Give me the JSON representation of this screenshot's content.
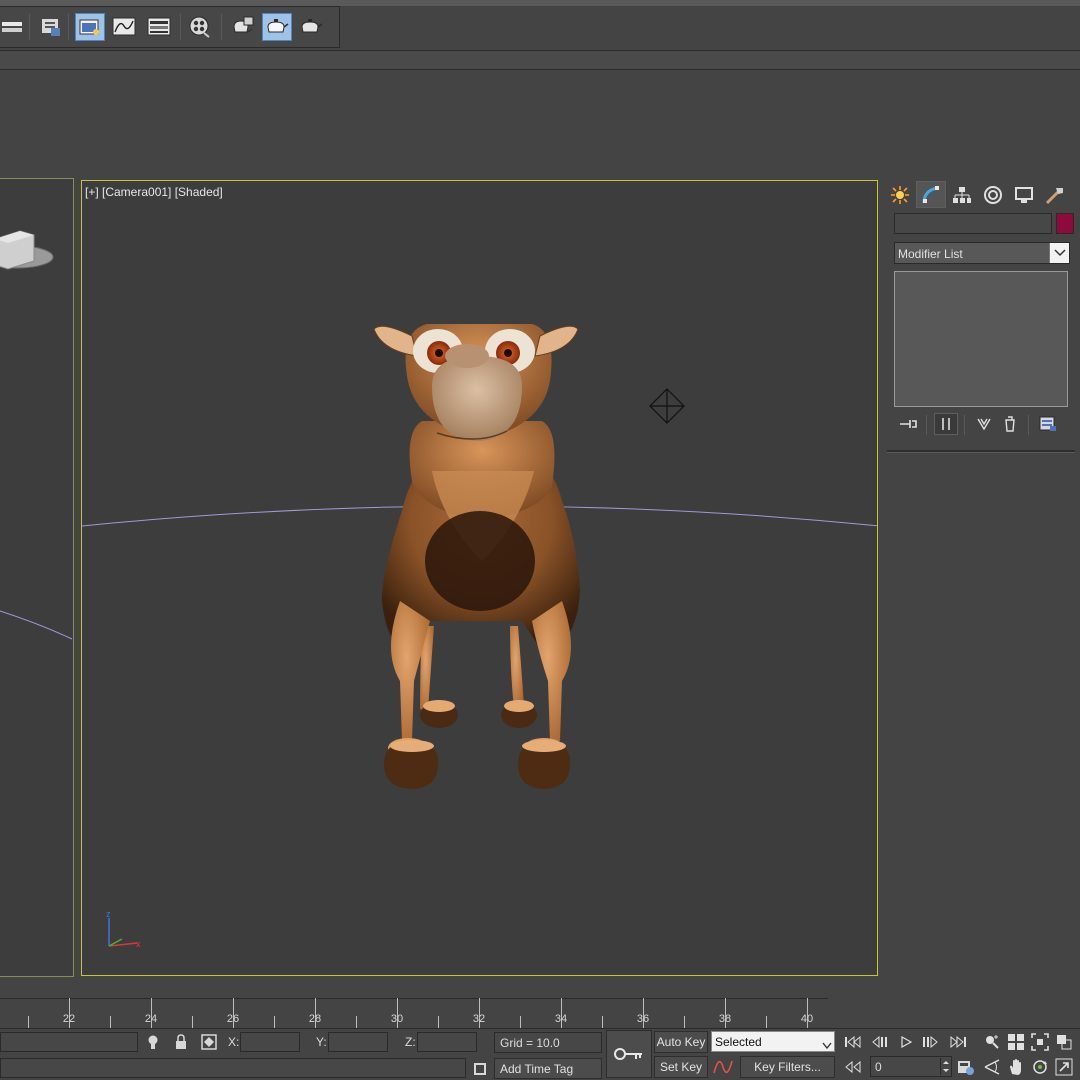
{
  "viewport": {
    "label": "[+] [Camera001] [Shaded]"
  },
  "command_panel": {
    "modifier_list": "Modifier List",
    "object_color": "#8e0a3c",
    "tabs": [
      "create-icon",
      "modify-icon",
      "hierarchy-icon",
      "motion-icon",
      "display-icon",
      "utilities-icon"
    ]
  },
  "timeline": {
    "ticks": [
      "22",
      "24",
      "26",
      "28",
      "30",
      "32",
      "34",
      "36",
      "38",
      "40"
    ]
  },
  "status": {
    "x_label": "X:",
    "y_label": "Y:",
    "z_label": "Z:",
    "x_value": "",
    "y_value": "",
    "z_value": "",
    "grid": "Grid = 10.0",
    "add_time_tag": "Add Time Tag",
    "auto_key": "Auto Key",
    "set_key": "Set Key",
    "selected": "Selected",
    "key_filters": "Key Filters...",
    "frame_value": "0"
  },
  "colors": {
    "active_viewport_border": "#c9c33a",
    "viewport_bg": "#3d3d3d",
    "ui_bg": "#444444"
  }
}
